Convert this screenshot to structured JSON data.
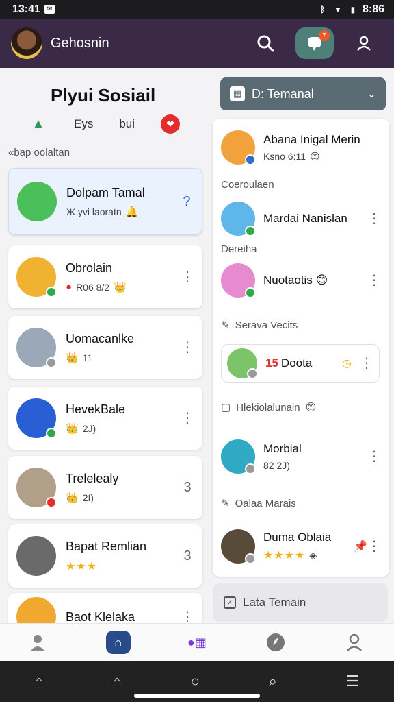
{
  "status_bar": {
    "time": "13:41",
    "battery": "8:86",
    "mail_icon": "mail-icon"
  },
  "app_bar": {
    "title": "Gehosnin",
    "notification_count": "7"
  },
  "left": {
    "heading": "Plyui Sosiail",
    "filters": [
      {
        "label": "Eys"
      },
      {
        "label": "bui"
      }
    ],
    "sub_label": "«bap oolaltan",
    "contacts": [
      {
        "name": "Dolpam Tamal",
        "sub": "Ж yvi laoratn",
        "action": "?",
        "avatar_color": "#4bbf59",
        "presence": ""
      },
      {
        "name": "Obrolain",
        "sub": "R06 8/2",
        "action": "⋮",
        "avatar_color": "#f0b233",
        "presence": "#2faa4a"
      },
      {
        "name": "Uomacanlke",
        "sub": "11",
        "action": "⋮",
        "avatar_color": "#9aa8b8",
        "presence": "#9a9a9a"
      },
      {
        "name": "HevekBale",
        "sub": "2J)",
        "action": "⋮",
        "avatar_color": "#2a5fd4",
        "presence": "#2faa4a"
      },
      {
        "name": "Trelelealy",
        "sub": "2I)",
        "action": "3",
        "avatar_color": "#b0a08a",
        "presence": "#e03030"
      },
      {
        "name": "Bapat Remlian",
        "sub": "★★★",
        "action": "3",
        "avatar_color": "#6a6a6a",
        "presence": ""
      },
      {
        "name": "Baot Klelaka",
        "sub": "",
        "action": "⋮",
        "avatar_color": "#f0a830",
        "presence": ""
      }
    ]
  },
  "right": {
    "dropdown_label": "D: Temanal",
    "top_contact": {
      "name": "Abana Inigal Merin",
      "sub": "Ksno 6:11"
    },
    "section1": "Coeroulaen",
    "c1": {
      "name": "Mardai Nanislan"
    },
    "section2": "Dereiha",
    "c2": {
      "name": "Nuotaotis"
    },
    "section3": "Serava Vecits",
    "card": {
      "num": "15",
      "name": "Doota"
    },
    "section4": "Hlekiolalunain",
    "c3": {
      "name": "Morbial",
      "sub": "82 2J)"
    },
    "section5": "Oalaa Marais",
    "c4": {
      "name": "Duma Oblaia",
      "stars": "★★★★"
    },
    "later_label": "Lata Temain"
  },
  "colors": {
    "app_bar": "#3a2a48",
    "accent": "#4e7f79",
    "selected_card": "#e9f2fd",
    "dropdown": "#5b6b73"
  },
  "icons": [
    "search-icon",
    "chat-icon",
    "profile-icon",
    "home-icon",
    "menu-icon"
  ]
}
